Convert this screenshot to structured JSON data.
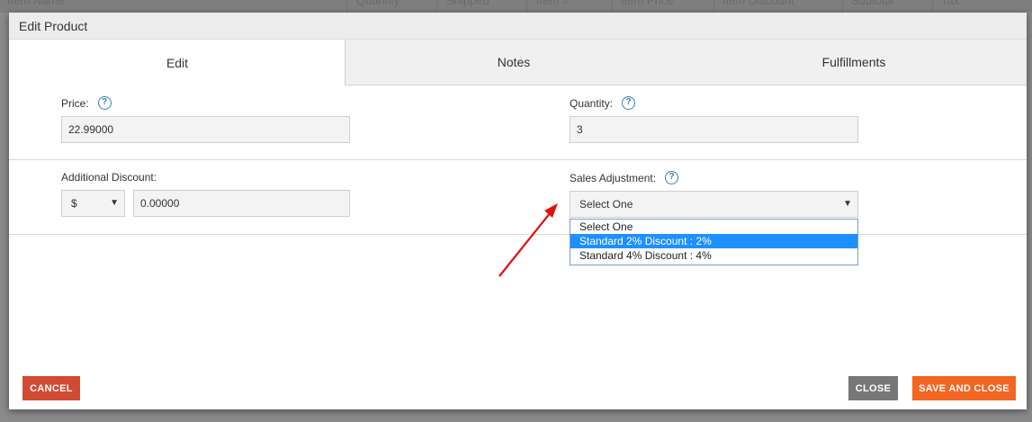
{
  "background_table": {
    "columns": [
      "Item Name",
      "Quantity",
      "Shipped",
      "Item #",
      "Item Price",
      "Item Discount",
      "Subtotal",
      "Tax"
    ]
  },
  "modal": {
    "title": "Edit Product",
    "tabs": [
      {
        "label": "Edit",
        "active": true
      },
      {
        "label": "Notes",
        "active": false
      },
      {
        "label": "Fulfillments",
        "active": false
      }
    ],
    "price": {
      "label": "Price:",
      "value": "22.99000"
    },
    "quantity": {
      "label": "Quantity:",
      "value": "3"
    },
    "additional_discount": {
      "label": "Additional Discount:",
      "type_value": "$",
      "value": "0.00000"
    },
    "sales_adjustment": {
      "label": "Sales Adjustment:",
      "selected": "Select One",
      "options": [
        {
          "label": "Select One",
          "highlighted": false
        },
        {
          "label": "Standard 2% Discount : 2%",
          "highlighted": true
        },
        {
          "label": "Standard 4% Discount : 4%",
          "highlighted": false
        }
      ]
    },
    "help_icon_glyph": "?",
    "caret_glyph": "▼",
    "buttons": {
      "cancel": "CANCEL",
      "close": "CLOSE",
      "save_and_close": "SAVE AND CLOSE"
    }
  },
  "colors": {
    "cancel": "#d14a32",
    "close": "#777777",
    "save": "#f26522",
    "highlight": "#1e90ff",
    "help_icon": "#3a7fb0",
    "annotation_arrow": "#e01010"
  }
}
